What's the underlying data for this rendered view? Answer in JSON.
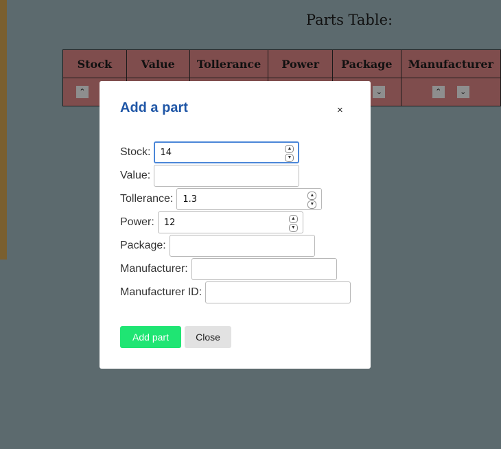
{
  "page": {
    "title": "Parts Table:"
  },
  "table": {
    "headers": [
      "Stock",
      "Value",
      "Tollerance",
      "Power",
      "Package",
      "Manufacturer"
    ]
  },
  "modal": {
    "title": "Add a part",
    "close_symbol": "×",
    "fields": {
      "stock": {
        "label": "Stock:",
        "value": "14"
      },
      "value": {
        "label": "Value:",
        "value": ""
      },
      "tollerance": {
        "label": "Tollerance:",
        "value": "1.3"
      },
      "power": {
        "label": "Power:",
        "value": "12"
      },
      "package": {
        "label": "Package:",
        "value": ""
      },
      "manufacturer": {
        "label": "Manufacturer:",
        "value": ""
      },
      "manufacturer_id": {
        "label": "Manufacturer ID:",
        "value": ""
      }
    },
    "add_button": "Add part",
    "close_button": "Close"
  },
  "colors": {
    "overlay": "#5c6a6e",
    "table_cell": "#7f4d4d",
    "title": "#1f56a6",
    "add_button": "#1fe573",
    "focus_border": "#4a86d8"
  },
  "icons": {
    "sort_up": "chevron-up-icon",
    "sort_down": "chevron-down-icon"
  }
}
